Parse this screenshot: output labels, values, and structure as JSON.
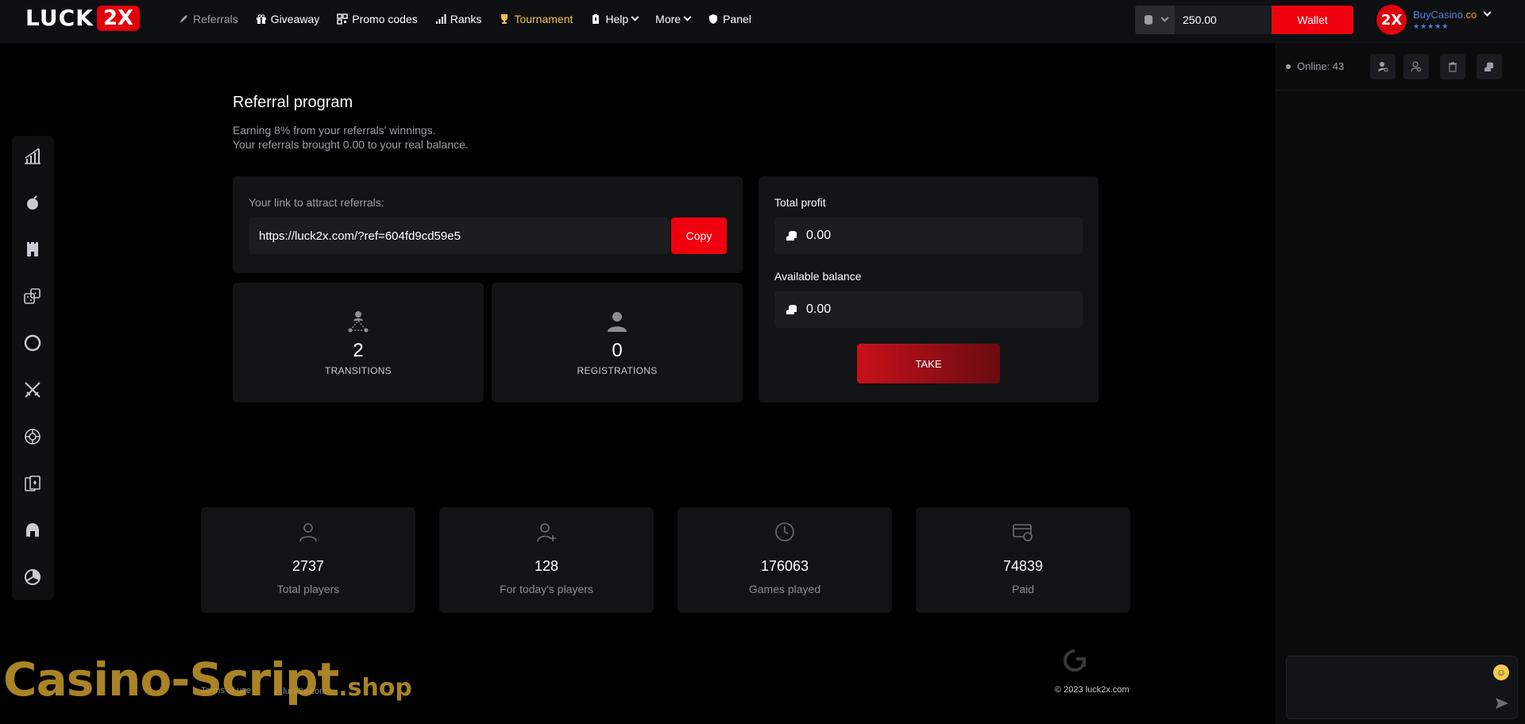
{
  "header": {
    "logo_text": "LUCK",
    "logo_badge": "2X",
    "nav": [
      {
        "label": "Referrals",
        "icon": "rocket-icon"
      },
      {
        "label": "Giveaway",
        "icon": "gift-icon"
      },
      {
        "label": "Promo codes",
        "icon": "qr-icon"
      },
      {
        "label": "Ranks",
        "icon": "signal-icon"
      },
      {
        "label": "Tournament",
        "icon": "trophy-icon"
      },
      {
        "label": "Help",
        "icon": "clipboard-icon"
      },
      {
        "label": "More"
      },
      {
        "label": "Panel",
        "icon": "shield-icon"
      }
    ],
    "balance": "250.00",
    "wallet_label": "Wallet",
    "avatar_text": "2X",
    "username_blue": "BuyCasino",
    "username_orange": ".co",
    "stars": "★★★★★"
  },
  "sidebar": {
    "icons": [
      "crash-icon",
      "bomb-icon",
      "tower-icon",
      "dice-icon",
      "wheel-icon",
      "swords-icon",
      "roulette-icon",
      "cards-icon",
      "helmet-icon",
      "pie-icon"
    ]
  },
  "referral": {
    "title": "Referral program",
    "subtitle1": "Earning 8% from your referrals' winnings.",
    "subtitle2": "Your referrals brought 0.00 to your real balance.",
    "link_label": "Your link to attract referrals:",
    "link_value": "https://luck2x.com/?ref=604fd9cd59e5",
    "copy_label": "Copy",
    "transitions_value": "2",
    "transitions_label": "TRANSITIONS",
    "registrations_value": "0",
    "registrations_label": "REGISTRATIONS",
    "total_profit_label": "Total profit",
    "total_profit_value": "0.00",
    "available_label": "Available balance",
    "available_value": "0.00",
    "take_label": "TAKE"
  },
  "stats": [
    {
      "value": "2737",
      "label": "Total players"
    },
    {
      "value": "128",
      "label": "For today's players"
    },
    {
      "value": "176063",
      "label": "Games played"
    },
    {
      "value": "74839",
      "label": "Paid"
    }
  ],
  "footer": {
    "terms": "Terms of use",
    "domain": "luck2x.com",
    "copyright": "© 2023 luck2x.com",
    "watermark_big": "Casino-Script",
    "watermark_small": ".shop"
  },
  "chat": {
    "online": "Online: 43",
    "placeholder": ""
  }
}
